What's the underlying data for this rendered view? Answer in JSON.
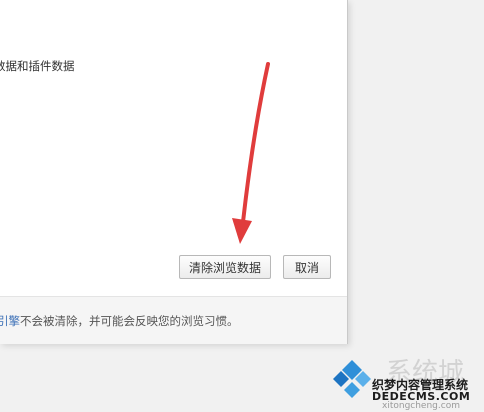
{
  "dialog": {
    "checkbox_label": "数据和插件数据",
    "clear_button_label": "清除浏览数据",
    "cancel_button_label": "取消",
    "footer": {
      "link_text": "引擎",
      "note_text": "不会被清除，并可能会反映您的浏览习惯。"
    }
  },
  "watermark": {
    "brand": "系统城",
    "overlay_line1": "织梦内容管理系统",
    "overlay_line2": "DEDECMS.COM",
    "site": "xitongcheng.com"
  },
  "colors": {
    "arrow": "#e03c3c",
    "link": "#3b6fb6"
  }
}
